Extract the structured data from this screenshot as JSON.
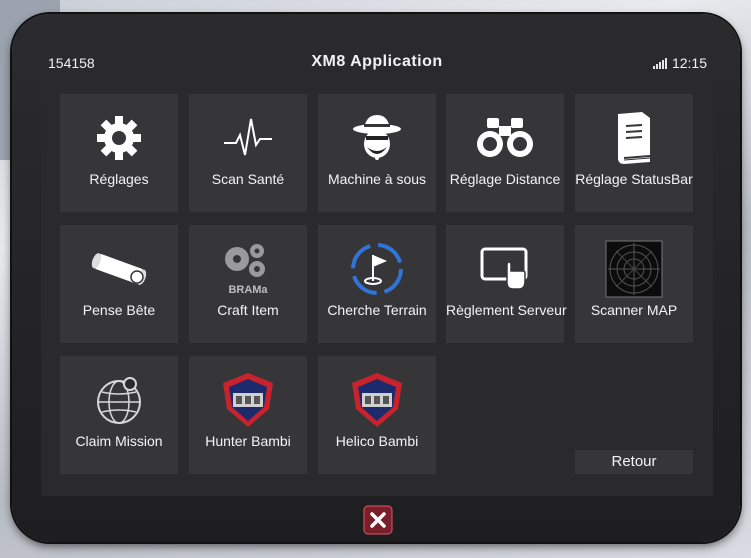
{
  "status": {
    "id": "154158",
    "title": "XM8  Application",
    "time": "12:15"
  },
  "apps": [
    {
      "label": "Réglages",
      "icon": "gear-icon"
    },
    {
      "label": "Scan Santé",
      "icon": "heartbeat-icon"
    },
    {
      "label": "Machine à sous",
      "icon": "gambler-icon"
    },
    {
      "label": "Réglage Distance",
      "icon": "binoculars-icon"
    },
    {
      "label": "Réglage StatusBar",
      "icon": "book-icon"
    },
    {
      "label": "Pense Bête",
      "icon": "scroll-icon"
    },
    {
      "label": "Craft Item",
      "icon": "gears-icon",
      "brand": "BRAMa"
    },
    {
      "label": "Cherche Terrain",
      "icon": "flag-target-icon"
    },
    {
      "label": "Règlement Serveur",
      "icon": "touch-screen-icon"
    },
    {
      "label": "Scanner  MAP",
      "icon": "radar-icon"
    },
    {
      "label": "Claim Mission",
      "icon": "globe-icon"
    },
    {
      "label": "Hunter Bambi",
      "icon": "shield-badge-icon"
    },
    {
      "label": "Helico Bambi",
      "icon": "shield-badge-icon"
    }
  ],
  "retour_label": "Retour",
  "close_icon": "close-icon",
  "colors": {
    "tile": "#363638",
    "screen": "#2a2a2c",
    "accent_blue": "#2f74d6",
    "badge_red": "#c8232c",
    "close_red": "#7a1e2a"
  }
}
